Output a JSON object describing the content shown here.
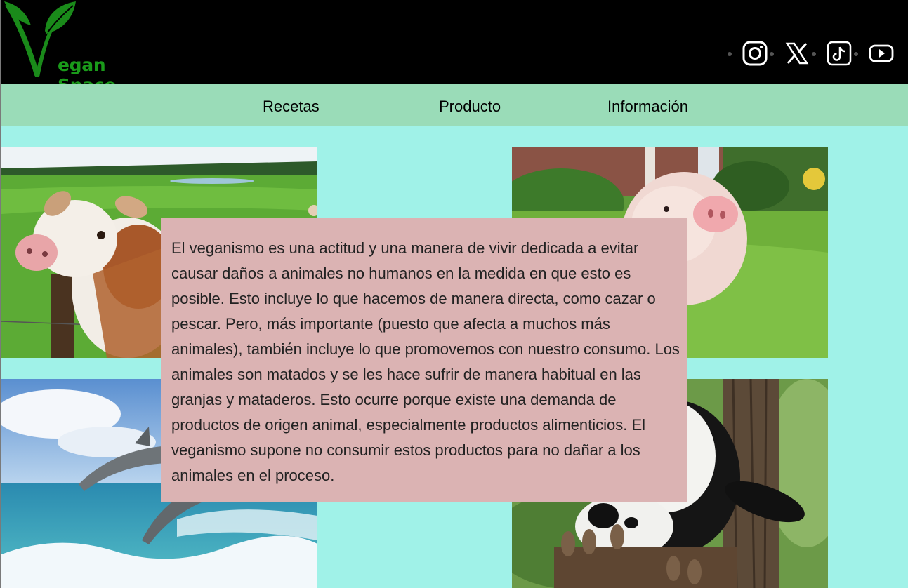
{
  "brand": {
    "name": "egan Space",
    "color": "#1a9a1a"
  },
  "social": [
    {
      "icon": "instagram-icon"
    },
    {
      "icon": "x-twitter-icon"
    },
    {
      "icon": "tiktok-icon"
    },
    {
      "icon": "youtube-icon"
    }
  ],
  "nav": {
    "items": [
      {
        "label": "Recetas"
      },
      {
        "label": "Producto"
      },
      {
        "label": "Información"
      }
    ]
  },
  "photos": [
    {
      "subject": "cow"
    },
    {
      "subject": "piglet"
    },
    {
      "subject": "dolphins"
    },
    {
      "subject": "panda"
    }
  ],
  "main": {
    "text": "El veganismo es una actitud y una manera de vivir dedicada a evitar causar daños a animales no humanos en la medida en que esto es posible. Esto incluye lo que hacemos de manera directa, como cazar o pescar. Pero, más importante (puesto que afecta a muchos más animales), también incluye lo que promovemos con nuestro consumo. Los animales son matados y se les hace sufrir de manera habitual en las granjas y mataderos. Esto ocurre porque existe una demanda de productos de origen animal, especialmente productos alimenticios. El veganismo supone no consumir estos productos para no dañar a los animales en el proceso."
  },
  "colors": {
    "header_bg": "#000000",
    "nav_bg": "#9adcb8",
    "page_bg": "#a0f2e8",
    "text_box_bg": "#dbb3b3"
  }
}
